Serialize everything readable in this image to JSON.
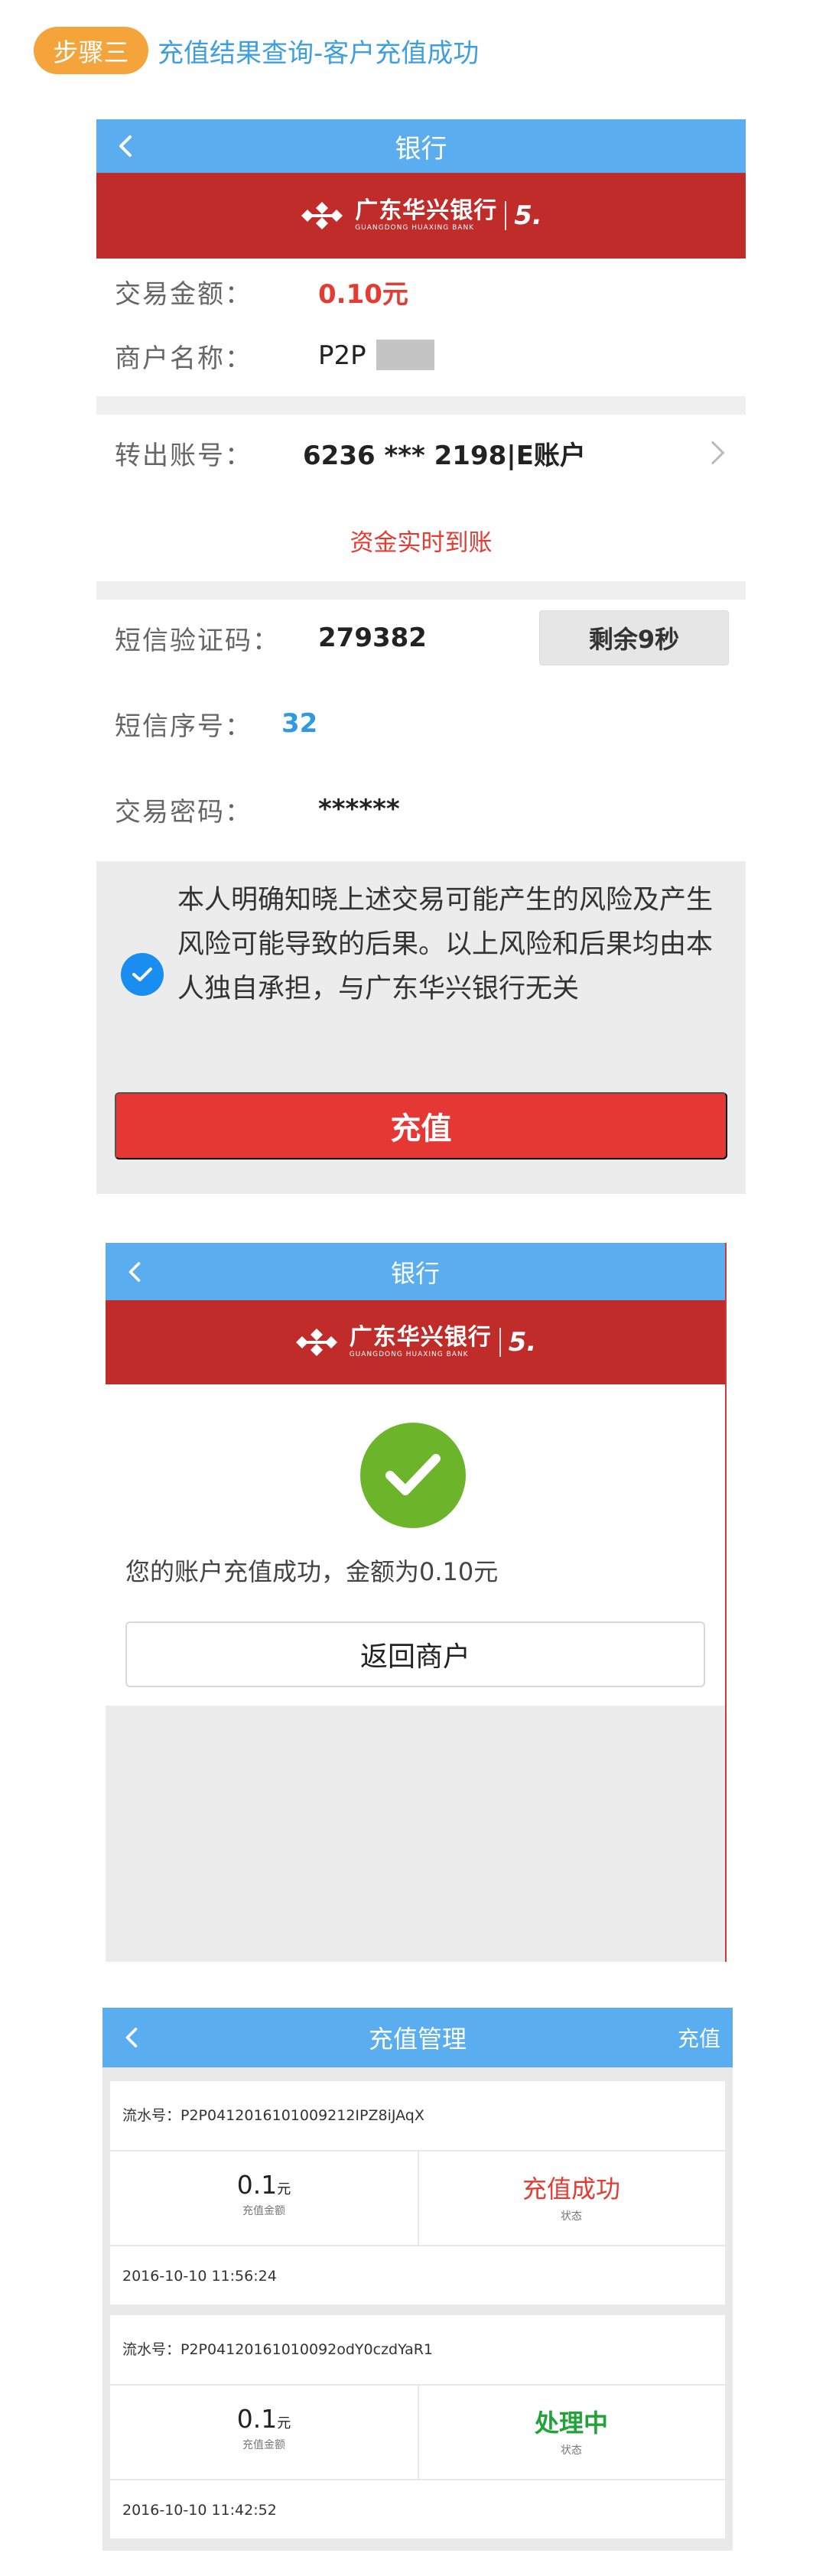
{
  "step": {
    "badge": "步骤三",
    "title": "充值结果查询-客户充值成功"
  },
  "colors": {
    "nav_blue": "#5aaef0",
    "bank_red": "#bf2c2a",
    "button_red": "#e53835",
    "success_green": "#6cb52a",
    "status_success_red": "#e43b33",
    "status_processing_green": "#22a33a",
    "link_blue": "#2f9ae0",
    "badge_orange": "#f5a43c"
  },
  "bank": {
    "name_cn": "广东华兴银行",
    "name_en": "GUANGDONG HUAXING BANK",
    "five": "5."
  },
  "screen1": {
    "nav_title": "银行",
    "amount_label": "交易金额：",
    "amount_value": "0.10元",
    "merchant_label": "商户名称：",
    "merchant_value": "P2P",
    "account_label": "转出账号：",
    "account_value": "6236 *** 2198|E账户",
    "realtime_notice": "资金实时到账",
    "sms_code_label": "短信验证码：",
    "sms_code_value": "279382",
    "countdown_button": "剩余9秒",
    "sms_seq_label": "短信序号：",
    "sms_seq_value": "32",
    "password_label": "交易密码：",
    "password_value": "******",
    "agreement_text": "本人明确知晓上述交易可能产生的风险及产生风险可能导致的后果。以上风险和后果均由本人独自承担，与广东华兴银行无关",
    "agreement_checked": true,
    "submit_button": "充值"
  },
  "screen2": {
    "nav_title": "银行",
    "success_message": "您的账户充值成功，金额为0.10元",
    "return_button": "返回商户"
  },
  "screen3": {
    "nav_title": "充值管理",
    "nav_action": "充值",
    "records": [
      {
        "serial": "流水号：P2P0412016101009212IPZ8iJAqX",
        "amount": "0.1",
        "amount_unit": "元",
        "amount_label": "充值金额",
        "status": "充值成功",
        "status_label": "状态",
        "time": "2016-10-10 11:56:24"
      },
      {
        "serial": "流水号：P2P04120161010092odY0czdYaR1",
        "amount": "0.1",
        "amount_unit": "元",
        "amount_label": "充值金额",
        "status": "处理中",
        "status_label": "状态",
        "time": "2016-10-10 11:42:52"
      }
    ]
  }
}
